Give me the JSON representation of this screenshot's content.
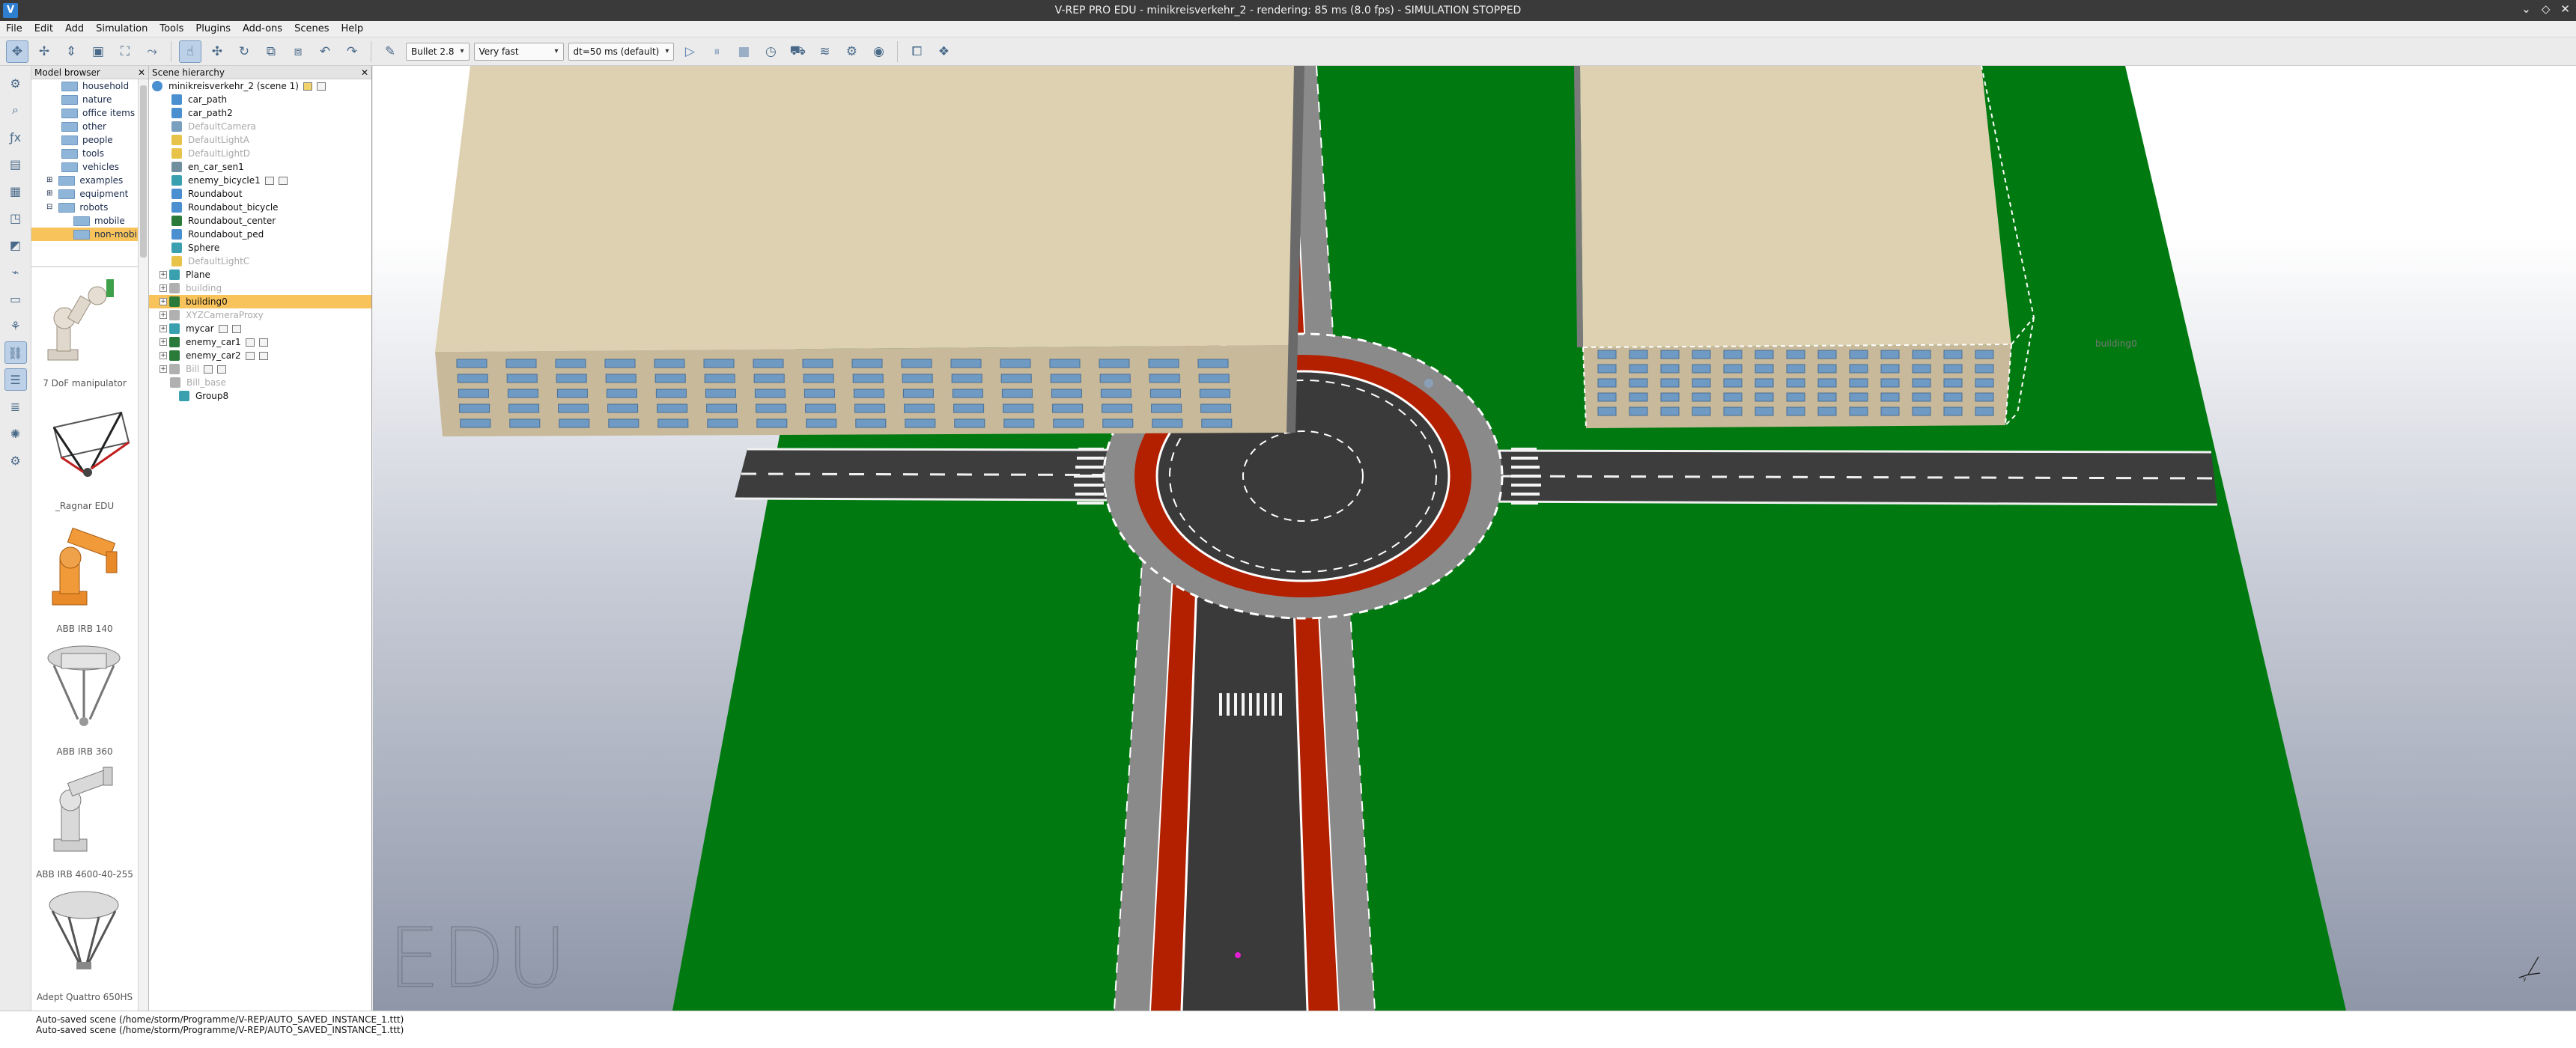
{
  "window": {
    "title": "V-REP PRO EDU - minikreisverkehr_2 - rendering: 85 ms (8.0 fps) - SIMULATION STOPPED",
    "app_icon": "vrep-logo-icon",
    "controls": [
      "minimize-icon",
      "maximize-icon",
      "close-icon"
    ]
  },
  "menu": [
    "File",
    "Edit",
    "Add",
    "Simulation",
    "Tools",
    "Plugins",
    "Add-ons",
    "Scenes",
    "Help"
  ],
  "toolbar": {
    "engine": "Bullet 2.8",
    "speed": "Very fast",
    "timestep": "dt=50 ms (default)"
  },
  "model_browser": {
    "title": "Model browser",
    "tree": [
      {
        "label": "household",
        "selected": false
      },
      {
        "label": "nature",
        "selected": false
      },
      {
        "label": "office items",
        "selected": false
      },
      {
        "label": "other",
        "selected": false
      },
      {
        "label": "people",
        "selected": false
      },
      {
        "label": "tools",
        "selected": false
      },
      {
        "label": "vehicles",
        "selected": false
      },
      {
        "label": "examples",
        "selected": false
      },
      {
        "label": "equipment",
        "selected": false
      },
      {
        "label": "robots",
        "selected": false
      },
      {
        "label": "mobile",
        "selected": false
      },
      {
        "label": "non-mobile",
        "selected": true
      }
    ],
    "thumbnails": [
      "7 DoF manipulator",
      "_Ragnar EDU",
      "ABB IRB 140",
      "ABB IRB 360",
      "ABB IRB 4600-40-255",
      "Adept Quattro 650HS"
    ]
  },
  "scene_hierarchy": {
    "title": "Scene hierarchy",
    "root": "minikreisverkehr_2 (scene 1)",
    "items": [
      {
        "label": "car_path",
        "dim": false,
        "selected": false
      },
      {
        "label": "car_path2",
        "dim": false,
        "selected": false
      },
      {
        "label": "DefaultCamera",
        "dim": true,
        "selected": false
      },
      {
        "label": "DefaultLightA",
        "dim": true,
        "selected": false
      },
      {
        "label": "DefaultLightD",
        "dim": true,
        "selected": false
      },
      {
        "label": "en_car_sen1",
        "dim": false,
        "selected": false
      },
      {
        "label": "enemy_bicycle1",
        "dim": false,
        "selected": false
      },
      {
        "label": "Roundabout",
        "dim": false,
        "selected": false
      },
      {
        "label": "Roundabout_bicycle",
        "dim": false,
        "selected": false
      },
      {
        "label": "Roundabout_center",
        "dim": false,
        "selected": false
      },
      {
        "label": "Roundabout_ped",
        "dim": false,
        "selected": false
      },
      {
        "label": "Sphere",
        "dim": false,
        "selected": false
      },
      {
        "label": "DefaultLightC",
        "dim": true,
        "selected": false
      },
      {
        "label": "Plane",
        "dim": false,
        "selected": false
      },
      {
        "label": "building",
        "dim": true,
        "selected": false
      },
      {
        "label": "building0",
        "dim": false,
        "selected": true
      },
      {
        "label": "XYZCameraProxy",
        "dim": true,
        "selected": false
      },
      {
        "label": "mycar",
        "dim": false,
        "selected": false
      },
      {
        "label": "enemy_car1",
        "dim": false,
        "selected": false
      },
      {
        "label": "enemy_car2",
        "dim": false,
        "selected": false
      },
      {
        "label": "Bill",
        "dim": true,
        "selected": false
      },
      {
        "label": "Bill_base",
        "dim": true,
        "selected": false
      },
      {
        "label": "Group8",
        "dim": false,
        "selected": false
      }
    ]
  },
  "viewport": {
    "watermark": "EDU",
    "selected_object_label": "building0"
  },
  "status": {
    "lines": [
      "Auto-saved scene (/home/storm/Programme/V-REP/AUTO_SAVED_INSTANCE_1.ttt)",
      "Auto-saved scene (/home/storm/Programme/V-REP/AUTO_SAVED_INSTANCE_1.ttt)"
    ]
  },
  "colors": {
    "grass": "#007a10",
    "asphalt": "#3a3a3a",
    "bike_lane": "#b32000",
    "sidewalk": "#8a8a8a",
    "building_roof": "#ddd1b1",
    "building_wall": "#c7b99a",
    "window": "#6f9ac4",
    "selection": "#f8c35a"
  }
}
